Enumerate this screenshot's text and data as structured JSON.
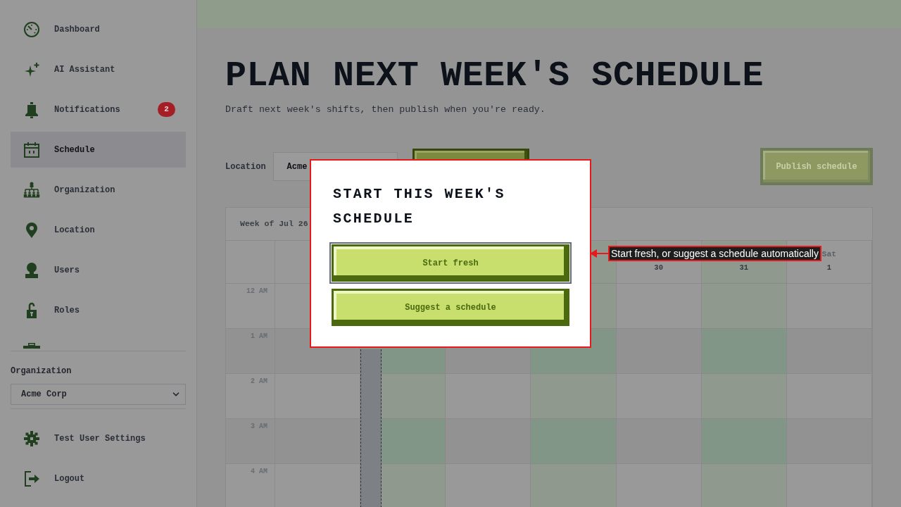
{
  "sidebar": {
    "items": [
      {
        "label": "Dashboard",
        "selected": false
      },
      {
        "label": "AI Assistant",
        "selected": false
      },
      {
        "label": "Notifications",
        "selected": false,
        "badge": "2"
      },
      {
        "label": "Schedule",
        "selected": true
      },
      {
        "label": "Organization",
        "selected": false
      },
      {
        "label": "Location",
        "selected": false
      },
      {
        "label": "Users",
        "selected": false
      },
      {
        "label": "Roles",
        "selected": false
      }
    ],
    "organization_select": {
      "label": "Organization",
      "value": "Acme Corp"
    },
    "footer_items": [
      {
        "label": "Test User Settings"
      },
      {
        "label": "Logout"
      }
    ]
  },
  "header": {
    "title": "PLAN NEXT WEEK'S SCHEDULE",
    "subtitle": "Draft next week's shifts, then publish when you're ready."
  },
  "toolbar": {
    "location_select": {
      "label": "Location",
      "value": "Acme"
    },
    "publish_button": {
      "label": "Publish schedule",
      "disabled": true
    }
  },
  "calendar": {
    "week_label": "Week of Jul 26",
    "days": [
      {
        "highlighted": false
      },
      {
        "highlighted": true
      },
      {
        "highlighted": false
      },
      {
        "highlighted": true
      },
      {
        "date": "30",
        "highlighted": false
      },
      {
        "date": "31",
        "highlighted": true
      },
      {
        "name": "Sat",
        "date": "1",
        "highlighted": false
      }
    ],
    "hours": [
      "12 AM",
      "1 AM",
      "2 AM",
      "3 AM",
      "4 AM"
    ]
  },
  "dialog": {
    "title": "START THIS WEEK'S SCHEDULE",
    "buttons": [
      {
        "label": "Start fresh",
        "focused": true
      },
      {
        "label": "Suggest a schedule",
        "focused": false
      }
    ]
  },
  "annotation": {
    "text": "Start fresh, or suggest a schedule automatically"
  }
}
